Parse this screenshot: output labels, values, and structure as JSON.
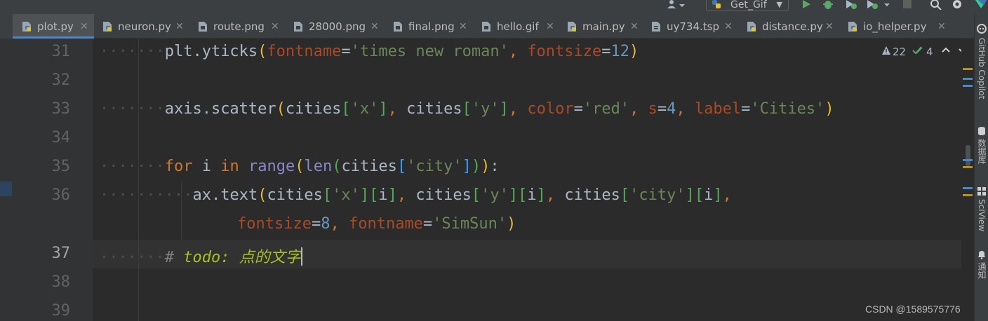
{
  "toolbar": {
    "run_config": "Get_Gif",
    "icons": [
      "user-icon",
      "python-icon",
      "run-icon",
      "debug-icon",
      "coverage-icon",
      "profile-icon",
      "stop-icon",
      "search-icon",
      "gear-icon",
      "jetbrains-logo-icon"
    ]
  },
  "tabs": [
    {
      "label": "plot.py",
      "icon": "python-file-icon",
      "active": true
    },
    {
      "label": "neuron.py",
      "icon": "python-file-icon",
      "active": false
    },
    {
      "label": "route.png",
      "icon": "image-file-icon",
      "active": false
    },
    {
      "label": "28000.png",
      "icon": "image-file-icon",
      "active": false
    },
    {
      "label": "final.png",
      "icon": "image-file-icon",
      "active": false
    },
    {
      "label": "hello.gif",
      "icon": "image-file-icon",
      "active": false
    },
    {
      "label": "main.py",
      "icon": "python-file-icon",
      "active": false
    },
    {
      "label": "uy734.tsp",
      "icon": "text-file-icon",
      "active": false
    },
    {
      "label": "distance.py",
      "icon": "python-file-icon",
      "active": false
    },
    {
      "label": "io_helper.py",
      "icon": "python-file-icon",
      "active": false
    }
  ],
  "inspection": {
    "warnings": "22",
    "weak_warnings": "4"
  },
  "line_numbers": [
    "31",
    "32",
    "33",
    "34",
    "35",
    "36",
    "37",
    "38",
    "39"
  ],
  "current_line": "37",
  "code": {
    "l31": {
      "ws": "·······",
      "p1": "plt.yticks",
      "b1": "(",
      "k1": "fontname",
      "eq1": "=",
      "s1": "'times new roman'",
      "c1": ", ",
      "k2": "fontsize",
      "eq2": "=",
      "n1": "12",
      "b2": ")"
    },
    "l33": {
      "ws": "·······",
      "p1": "axis.scatter",
      "b1": "(",
      "p2": "cities",
      "b2": "[",
      "s1": "'x'",
      "b3": "]",
      "c1": ", ",
      "p3": "cities",
      "b4": "[",
      "s2": "'y'",
      "b5": "]",
      "c2": ", ",
      "k1": "color",
      "eq1": "=",
      "s3": "'red'",
      "c3": ", ",
      "k2": "s",
      "eq2": "=",
      "n1": "4",
      "c4": ", ",
      "k3": "label",
      "eq3": "=",
      "s4": "'Cities'",
      "b6": ")"
    },
    "l35": {
      "ws": "·······",
      "kw1": "for",
      "p1": " i ",
      "kw2": "in",
      "sp": " ",
      "bi1": "range",
      "b1": "(",
      "bi2": "len",
      "b2": "(",
      "p2": "cities",
      "b3": "[",
      "s1": "'city'",
      "b4": "]",
      "b5": ")",
      "b6": ")",
      "col": ":"
    },
    "l36": {
      "ws": "·······",
      "ws2": "···",
      "p1": "ax.text",
      "b1": "(",
      "p2": "cities",
      "b2": "[",
      "s1": "'x'",
      "b3": "]",
      "b4": "[",
      "p3": "i",
      "b5": "]",
      "c1": ", ",
      "p4": "cities",
      "b6": "[",
      "s2": "'y'",
      "b7": "]",
      "b8": "[",
      "p5": "i",
      "b9": "]",
      "c2": ", ",
      "p6": "cities",
      "b10": "[",
      "s3": "'city'",
      "b11": "]",
      "b12": "[",
      "p7": "i",
      "b13": "]",
      "c3": ","
    },
    "l36w": {
      "k1": "fontsize",
      "eq1": "=",
      "n1": "8",
      "c1": ", ",
      "k2": "fontname",
      "eq2": "=",
      "s1": "'SimSun'",
      "b1": ")"
    },
    "l37": {
      "ws": "·······",
      "hash": "# ",
      "todo": "todo: 点的文字"
    }
  },
  "right_tools": [
    "GitHub Copilot",
    "数据库",
    "SciView",
    "通知"
  ],
  "watermark": "CSDN @1589575776"
}
